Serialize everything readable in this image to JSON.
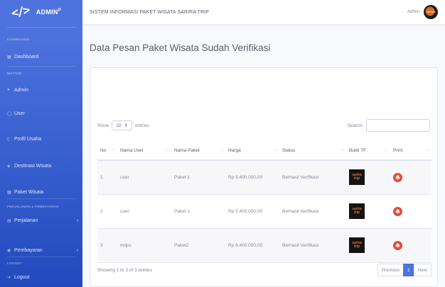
{
  "sidebar": {
    "brand": "ADMIN",
    "brand_sup": "P",
    "headings": [
      "DASHBOARD",
      "MASTER",
      "PERJALANAN & PEMBAYARAN",
      "LOGOUT"
    ],
    "items": [
      {
        "label": "Dashboard",
        "icon": "dashboard-icon"
      },
      {
        "label": "Admin",
        "icon": "user-icon"
      },
      {
        "label": "User",
        "icon": "users-icon"
      },
      {
        "label": "Profil Usaha",
        "icon": "building-icon"
      },
      {
        "label": "Destinasi Wisata",
        "icon": "map-icon"
      },
      {
        "label": "Paket Wisata",
        "icon": "package-icon"
      },
      {
        "label": "Perjalanan",
        "icon": "trip-icon"
      },
      {
        "label": "Pembayaran",
        "icon": "payment-icon"
      },
      {
        "label": "Logout",
        "icon": "logout-icon"
      }
    ]
  },
  "topbar": {
    "title": "SISTEM INFORMASI PAKET WISATA SARIRA TRIP",
    "username": "Admin"
  },
  "page": {
    "title": "Data Pesan Paket Wisata Sudah Verifikasi"
  },
  "datatable": {
    "show_label": "Show",
    "entries_value": "10",
    "entries_label": "entries",
    "search_label": "Search:",
    "search_value": "",
    "columns": [
      "No",
      "Nama User",
      "Nama Paket",
      "Harga",
      "Status",
      "Bukti TF",
      "Print"
    ],
    "rows": [
      {
        "no": "1",
        "user": "user",
        "paket": "Paket 1",
        "harga": "Rp 5.400.000,00",
        "status": "Berhasil Verifikasi"
      },
      {
        "no": "2",
        "user": "user",
        "paket": "Paket 1",
        "harga": "Rp 5.400.000,00",
        "status": "Berhasil Verifikasi"
      },
      {
        "no": "3",
        "user": "mdps",
        "paket": "Paket2",
        "harga": "Rp 6.400.000,00",
        "status": "Berhasil Verifikasi"
      }
    ],
    "thumb_text": [
      "sarira",
      "trip"
    ],
    "info": "Showing 1 to 3 of 3 entries",
    "pager": {
      "previous": "Previous",
      "current": "1",
      "next": "Next"
    }
  },
  "colors": {
    "primary": "#4e73df",
    "danger": "#e74a3b",
    "text": "#5a5c69",
    "muted": "#858796"
  }
}
